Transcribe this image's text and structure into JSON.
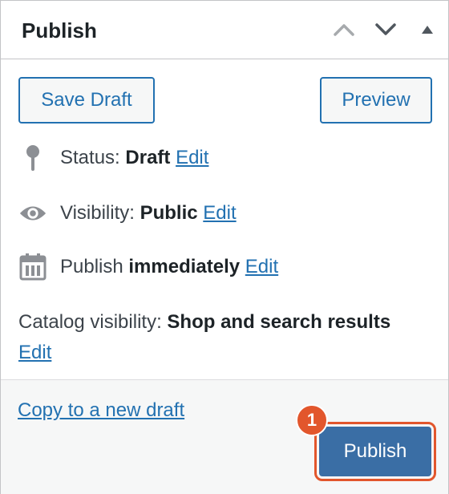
{
  "header": {
    "title": "Publish",
    "move_up_icon": "chevron-up-icon",
    "move_down_icon": "chevron-down-icon",
    "toggle_icon": "triangle-up-icon"
  },
  "actions": {
    "save_draft_label": "Save Draft",
    "preview_label": "Preview"
  },
  "status": {
    "label": "Status:",
    "value": "Draft",
    "edit_label": "Edit",
    "icon": "pin-icon"
  },
  "visibility": {
    "label": "Visibility:",
    "value": "Public",
    "edit_label": "Edit",
    "icon": "eye-icon"
  },
  "schedule": {
    "label": "Publish",
    "value": "immediately",
    "edit_label": "Edit",
    "icon": "calendar-icon"
  },
  "catalog": {
    "label": "Catalog visibility:",
    "value": "Shop and search results",
    "edit_label": "Edit"
  },
  "footer": {
    "copy_link_label": "Copy to a new draft",
    "publish_label": "Publish",
    "step_badge": "1",
    "highlight_color": "#e2562c",
    "primary_color": "#3a6ea5"
  }
}
